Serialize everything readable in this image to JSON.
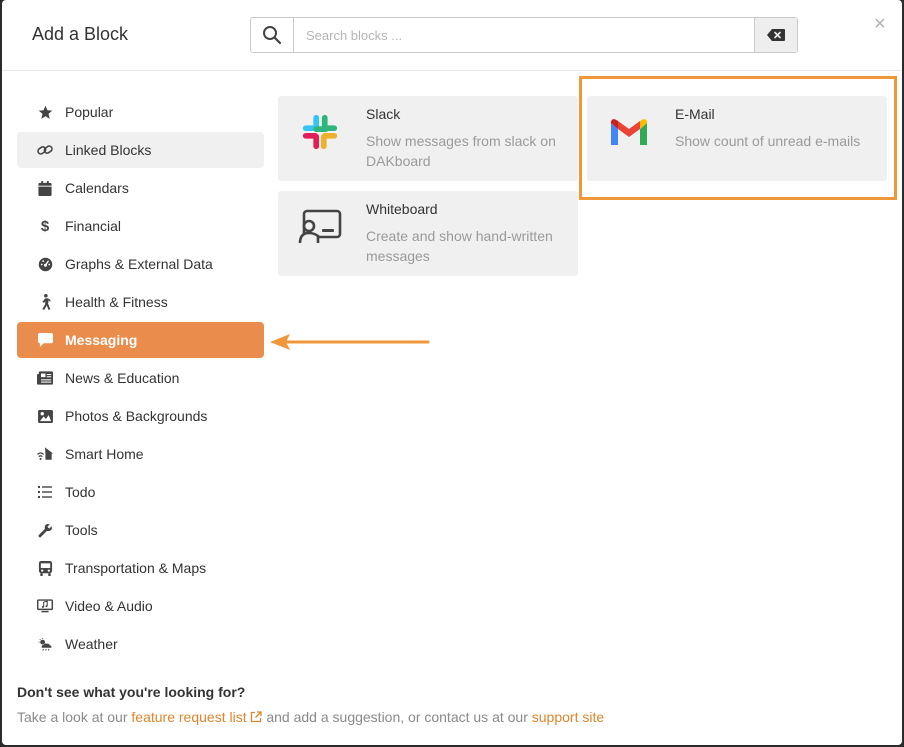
{
  "header": {
    "title": "Add a Block",
    "search_placeholder": "Search blocks ...",
    "close_symbol": "×"
  },
  "sidebar": {
    "items": [
      {
        "label": "Popular",
        "icon": "star-icon"
      },
      {
        "label": "Linked Blocks",
        "icon": "link-icon",
        "state": "hover"
      },
      {
        "label": "Calendars",
        "icon": "calendar-icon"
      },
      {
        "label": "Financial",
        "icon": "dollar-icon"
      },
      {
        "label": "Graphs & External Data",
        "icon": "dashboard-icon"
      },
      {
        "label": "Health & Fitness",
        "icon": "walking-icon"
      },
      {
        "label": "Messaging",
        "icon": "comment-icon",
        "state": "active"
      },
      {
        "label": "News & Education",
        "icon": "newspaper-icon"
      },
      {
        "label": "Photos & Backgrounds",
        "icon": "image-icon"
      },
      {
        "label": "Smart Home",
        "icon": "smart-home-icon"
      },
      {
        "label": "Todo",
        "icon": "list-icon"
      },
      {
        "label": "Tools",
        "icon": "wrench-icon"
      },
      {
        "label": "Transportation & Maps",
        "icon": "bus-icon"
      },
      {
        "label": "Video & Audio",
        "icon": "video-audio-icon"
      },
      {
        "label": "Weather",
        "icon": "weather-icon"
      }
    ]
  },
  "blocks": [
    {
      "title": "Slack",
      "description": "Show messages from slack on DAKboard",
      "icon": "slack-logo"
    },
    {
      "title": "E-Mail",
      "description": "Show count of unread e-mails",
      "icon": "gmail-logo"
    },
    {
      "title": "Whiteboard",
      "description": "Create and show hand-written messages",
      "icon": "whiteboard-icon"
    }
  ],
  "footer": {
    "question": "Don't see what you're looking for?",
    "text_1": "Take a look at our ",
    "link_1": "feature request list",
    "text_2": " and add a suggestion, or contact us at our ",
    "link_2": "support site"
  },
  "colors": {
    "accent": "#ea8c4b",
    "annotation": "#f0973a",
    "link": "#e0852d"
  }
}
